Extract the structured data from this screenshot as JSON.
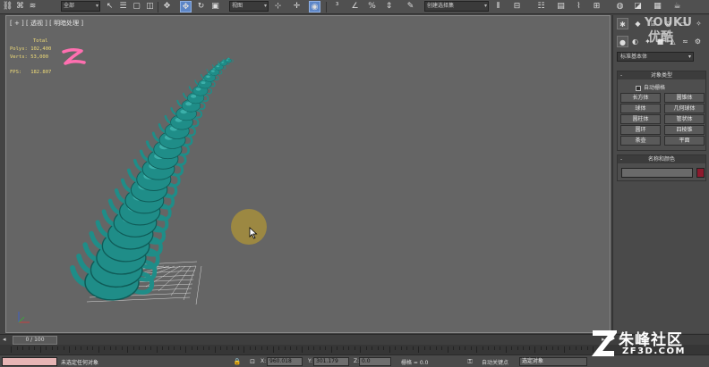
{
  "toolbar": {
    "selection_filter": "全部",
    "reference_coord": "视图",
    "named_selection": "创建选择集",
    "icons": [
      "link-icon",
      "unlink-icon",
      "bind-space-warp-icon",
      "select-object-icon",
      "select-by-name-icon",
      "rect-selection-icon",
      "window-crossing-icon",
      "select-move-icon",
      "select-rotate-icon",
      "select-scale-icon",
      "pivot-center-icon",
      "select-manipulate-icon",
      "keyboard-shortcut-icon",
      "snap-3-icon",
      "angle-snap-icon",
      "percent-snap-icon",
      "spinner-snap-icon",
      "edit-named-selection-icon",
      "mirror-icon",
      "align-icon",
      "layer-manager-icon",
      "graphite-ribbon-icon",
      "curve-editor-icon",
      "schematic-view-icon",
      "material-editor-icon",
      "render-setup-icon",
      "rendered-frame-icon",
      "render-icon"
    ]
  },
  "viewport": {
    "label": "[ + ] [ 透视 ] [ 明暗处理 ]",
    "stats": {
      "header": "Total",
      "polys_label": "Polys:",
      "polys_value": "102,400",
      "verts_label": "Verts:",
      "verts_value": "53,000",
      "fps_label": "FPS:",
      "fps_value": "182.807"
    },
    "teapot_color": "#1f8d88",
    "background_color": "#656565"
  },
  "command_panel": {
    "tabs": [
      "create-tab",
      "modify-tab",
      "hierarchy-tab",
      "motion-tab",
      "display-tab",
      "utilities-tab"
    ],
    "category_dropdown": "标准基本体",
    "object_type_header": "对象类型",
    "autogrid_label": "自动栅格",
    "object_buttons": [
      "长方体",
      "圆锥体",
      "球体",
      "几何球体",
      "圆柱体",
      "管状体",
      "圆环",
      "四棱锥",
      "茶壶",
      "平面"
    ],
    "name_color_header": "名称和颜色",
    "object_color": "#8c1b2e"
  },
  "timeline": {
    "frame_display": "0 / 100"
  },
  "status_bar": {
    "status_text": "未选定任何对象",
    "x_label": "X:",
    "x_value": "960.018",
    "y_label": "Y:",
    "y_value": "301.179",
    "z_label": "Z:",
    "z_value": "0.0",
    "grid_label": "栅格 = 0.0",
    "auto_key_label": "自动关键点",
    "selected_dropdown": "选定对象"
  },
  "watermarks": {
    "youku_en": "YOUKU",
    "youku_cn": "优酷",
    "zf_cn": "朱峰社区",
    "zf_url": "ZF3D.COM"
  }
}
